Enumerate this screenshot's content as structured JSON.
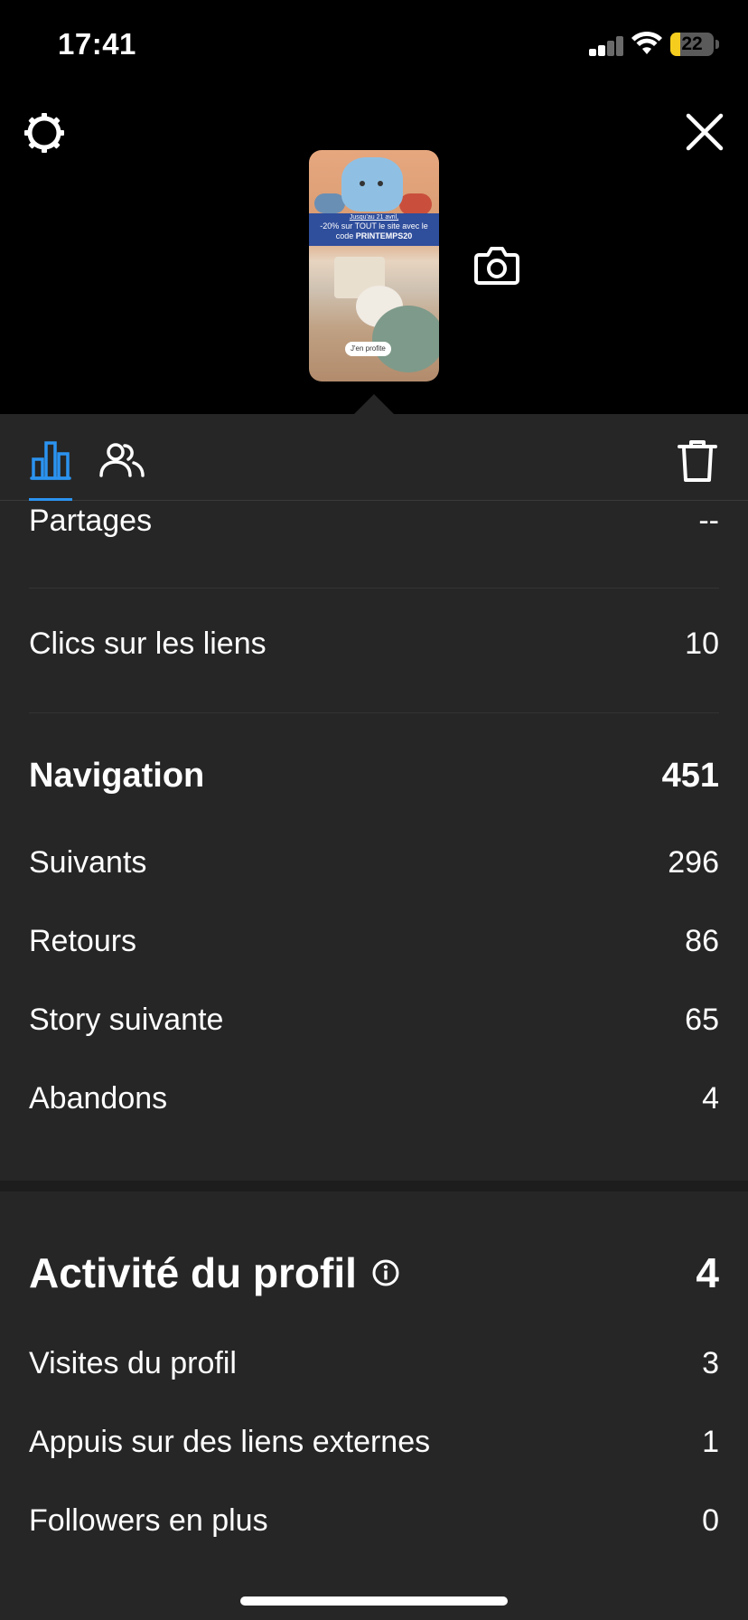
{
  "status_bar": {
    "time": "17:41",
    "battery": "22",
    "battery_level": 0.22,
    "battery_color": "#f5cd1f"
  },
  "header": {
    "settings_icon": "gear-icon",
    "close_icon": "close-icon",
    "camera_icon": "camera-icon"
  },
  "story_preview": {
    "banner_line1": "Jusqu'au 21 avril,",
    "banner_line2": "-20% sur TOUT le site avec le",
    "banner_line3_prefix": "code ",
    "banner_code": "PRINTEMPS20",
    "link_sticker": "J'en profite"
  },
  "tabs": {
    "items": [
      {
        "icon": "bar-chart-icon",
        "active": true
      },
      {
        "icon": "people-icon",
        "active": false
      }
    ],
    "trash_icon": "trash-icon",
    "accent": "#2b93f0"
  },
  "stats": {
    "partages": {
      "label": "Partages",
      "value": "--"
    },
    "clics": {
      "label": "Clics sur les liens",
      "value": "10"
    },
    "navigation": {
      "label": "Navigation",
      "value": "451",
      "items": [
        {
          "label": "Suivants",
          "value": "296"
        },
        {
          "label": "Retours",
          "value": "86"
        },
        {
          "label": "Story suivante",
          "value": "65"
        },
        {
          "label": "Abandons",
          "value": "4"
        }
      ]
    },
    "profile_activity": {
      "label": "Activité du profil",
      "value": "4",
      "info_icon": "info-icon",
      "items": [
        {
          "label": "Visites du profil",
          "value": "3"
        },
        {
          "label": "Appuis sur des liens externes",
          "value": "1"
        },
        {
          "label": "Followers en plus",
          "value": "0"
        }
      ]
    }
  }
}
